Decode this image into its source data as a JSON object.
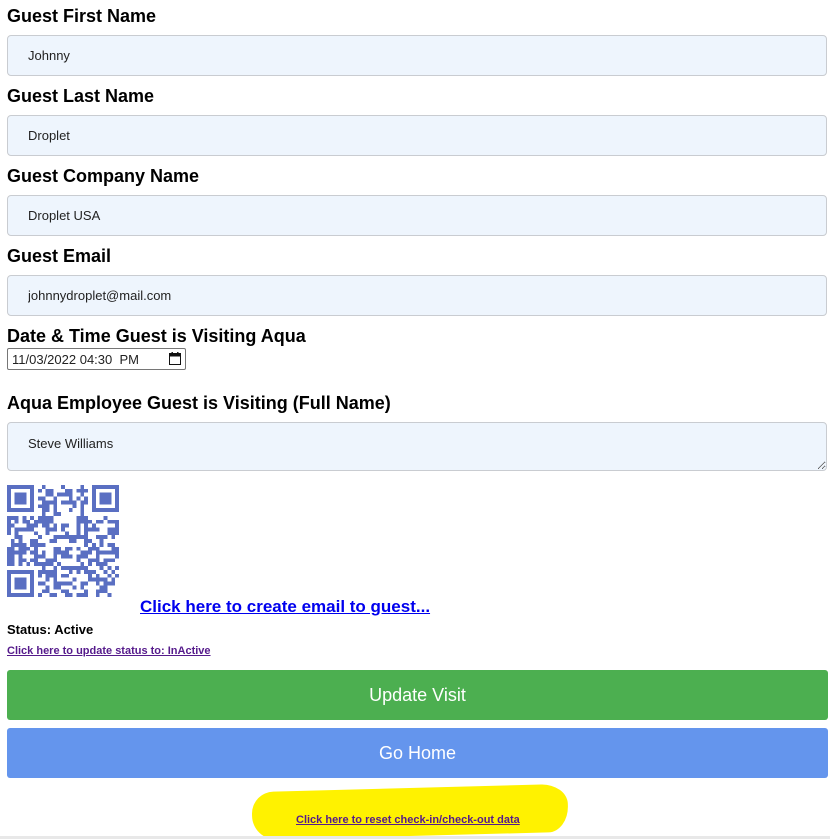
{
  "form": {
    "first_name": {
      "label": "Guest First Name",
      "value": "Johnny"
    },
    "last_name": {
      "label": "Guest Last Name",
      "value": "Droplet"
    },
    "company": {
      "label": "Guest Company Name",
      "value": "Droplet USA"
    },
    "email": {
      "label": "Guest Email",
      "value": "johnnydroplet@mail.com"
    },
    "visit_datetime": {
      "label": "Date & Time Guest is Visiting Aqua",
      "value": "11/03/2022 04:30  PM"
    },
    "employee": {
      "label": "Aqua Employee Guest is Visiting (Full Name)",
      "value": "Steve Williams"
    }
  },
  "qr_code": {
    "icon": "qr-code",
    "color": "#5a6fc2"
  },
  "email_link": "Click here to create email to guest...",
  "status": {
    "text": "Status: Active",
    "update_link": "Click here to update status to: InActive"
  },
  "buttons": {
    "update_visit": "Update Visit",
    "go_home": "Go Home"
  },
  "reset_link": "Click here to reset check-in/check-out data",
  "colors": {
    "update_button": "#4caf50",
    "home_button": "#6495ed",
    "field_bg": "#eef5fd",
    "highlight": "#fff200"
  }
}
